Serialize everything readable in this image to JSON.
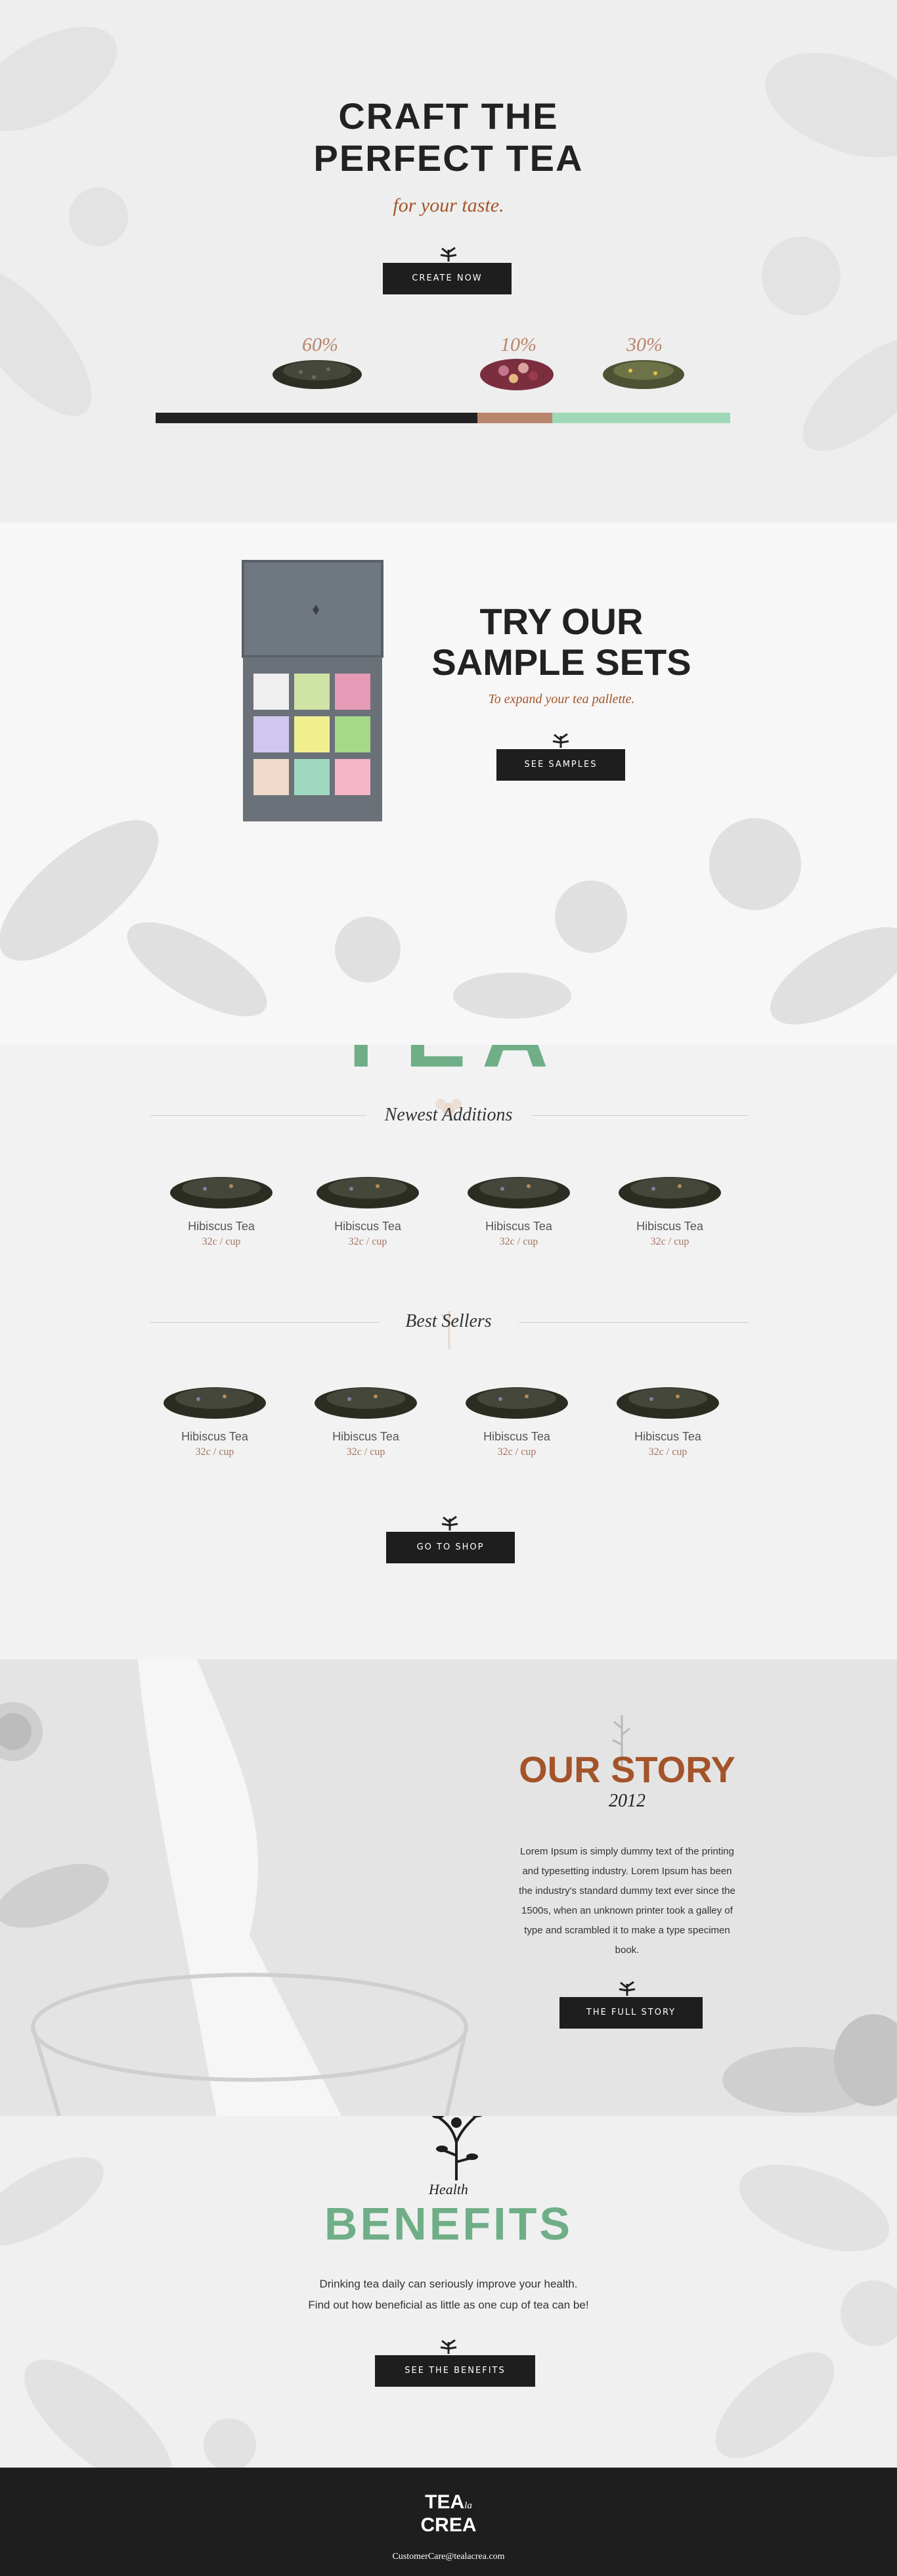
{
  "hero": {
    "title_line1": "CRAFT THE",
    "title_line2": "PERFECT TEA",
    "subtitle": "for your taste.",
    "cta": "CREATE NOW",
    "blend": [
      {
        "percent_label": "60%",
        "fraction": 0.56,
        "color": "#222222"
      },
      {
        "percent_label": "10%",
        "fraction": 0.13,
        "color": "#b8846c"
      },
      {
        "percent_label": "30%",
        "fraction": 0.31,
        "color": "#9fd8b6"
      }
    ]
  },
  "sample": {
    "title_line1": "TRY OUR",
    "title_line2": "SAMPLE SETS",
    "subtitle": "To expand your tea pallette.",
    "cta": "SEE SAMPLES"
  },
  "tea": {
    "heading": "TEA",
    "newest": {
      "label": "Newest Additions",
      "items": [
        {
          "name": "Hibiscus Tea",
          "price": "32c / cup"
        },
        {
          "name": "Hibiscus Tea",
          "price": "32c / cup"
        },
        {
          "name": "Hibiscus Tea",
          "price": "32c / cup"
        },
        {
          "name": "Hibiscus Tea",
          "price": "32c / cup"
        }
      ]
    },
    "best": {
      "label": "Best Sellers",
      "items": [
        {
          "name": "Hibiscus Tea",
          "price": "32c / cup"
        },
        {
          "name": "Hibiscus Tea",
          "price": "32c / cup"
        },
        {
          "name": "Hibiscus Tea",
          "price": "32c / cup"
        },
        {
          "name": "Hibiscus Tea",
          "price": "32c / cup"
        }
      ]
    },
    "cta": "GO TO SHOP"
  },
  "story": {
    "title": "OUR STORY",
    "year": "2012",
    "body": "Lorem Ipsum is simply dummy text of the printing and typesetting industry. Lorem Ipsum has been the industry's standard dummy text ever since the 1500s, when an unknown printer took a galley of type and scrambled it to make a type specimen book.",
    "cta": "THE FULL STORY"
  },
  "benefits": {
    "kicker": "Health",
    "title": "BENEFITS",
    "line1": "Drinking tea daily can seriously improve your health.",
    "line2": "Find out how beneficial as little as one cup of tea can be!",
    "cta": "SEE THE BENEFITS"
  },
  "footer": {
    "logo_line1": "TEA",
    "logo_small": "la",
    "logo_line2": "CREA",
    "email": "CustomerCare@tealacrea.com"
  },
  "colors": {
    "accent_green": "#6fae87",
    "accent_brown": "#a4542a",
    "accent_pink": "#a4735e",
    "dark": "#1e1e1e"
  }
}
